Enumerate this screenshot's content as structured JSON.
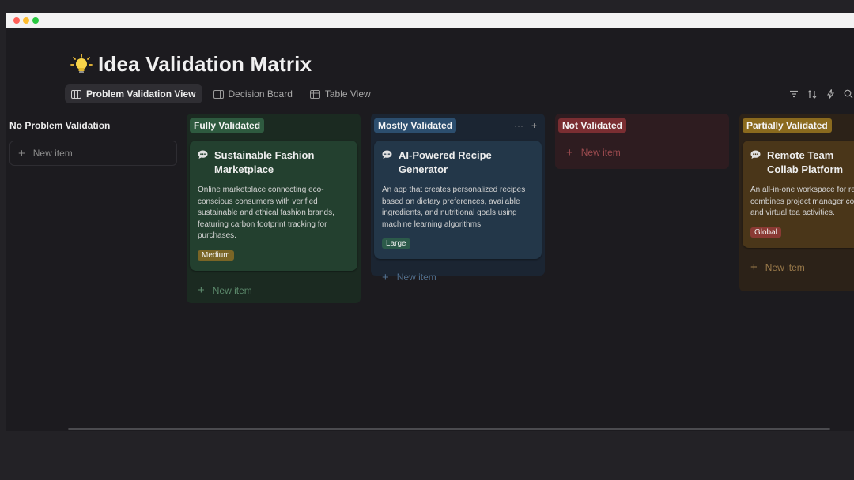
{
  "page": {
    "title": "Idea Validation Matrix"
  },
  "tabs": [
    {
      "label": "Problem Validation View",
      "active": true
    },
    {
      "label": "Decision Board",
      "active": false
    },
    {
      "label": "Table View",
      "active": false
    }
  ],
  "toolbar": {
    "icons": [
      "filter-icon",
      "sort-icon",
      "lightning-icon",
      "search-icon"
    ]
  },
  "board": {
    "new_item_label": "New item",
    "columns": [
      {
        "label": "No Problem Validation",
        "color": "#1c1b1f",
        "cards": []
      },
      {
        "label": "Fully Validated",
        "color": "#1f3a2b",
        "cards": [
          {
            "title": "Sustainable Fashion Marketplace",
            "description": "Online marketplace connecting eco-conscious consumers with verified sustainable and ethical fashion brands, featuring carbon footprint tracking for purchases.",
            "tag": "Medium",
            "tag_color": "#7a6526"
          }
        ]
      },
      {
        "label": "Mostly Validated",
        "color": "#1e3043",
        "cards": [
          {
            "title": "AI-Powered Recipe Generator",
            "description": "An app that creates personalized recipes based on dietary preferences, available ingredients, and nutritional goals using machine learning algorithms.",
            "tag": "Large",
            "tag_color": "#2c5a4a"
          }
        ]
      },
      {
        "label": "Not Validated",
        "color": "#4a2227",
        "cards": []
      },
      {
        "label": "Partially Validated",
        "color": "#4a3619",
        "cards": [
          {
            "title": "Remote Team Collab Platform",
            "description": "An all-in-one workspace for rem that combines project manager communication, and virtual tea activities.",
            "tag": "Global",
            "tag_color": "#8a3a34"
          }
        ]
      }
    ]
  }
}
